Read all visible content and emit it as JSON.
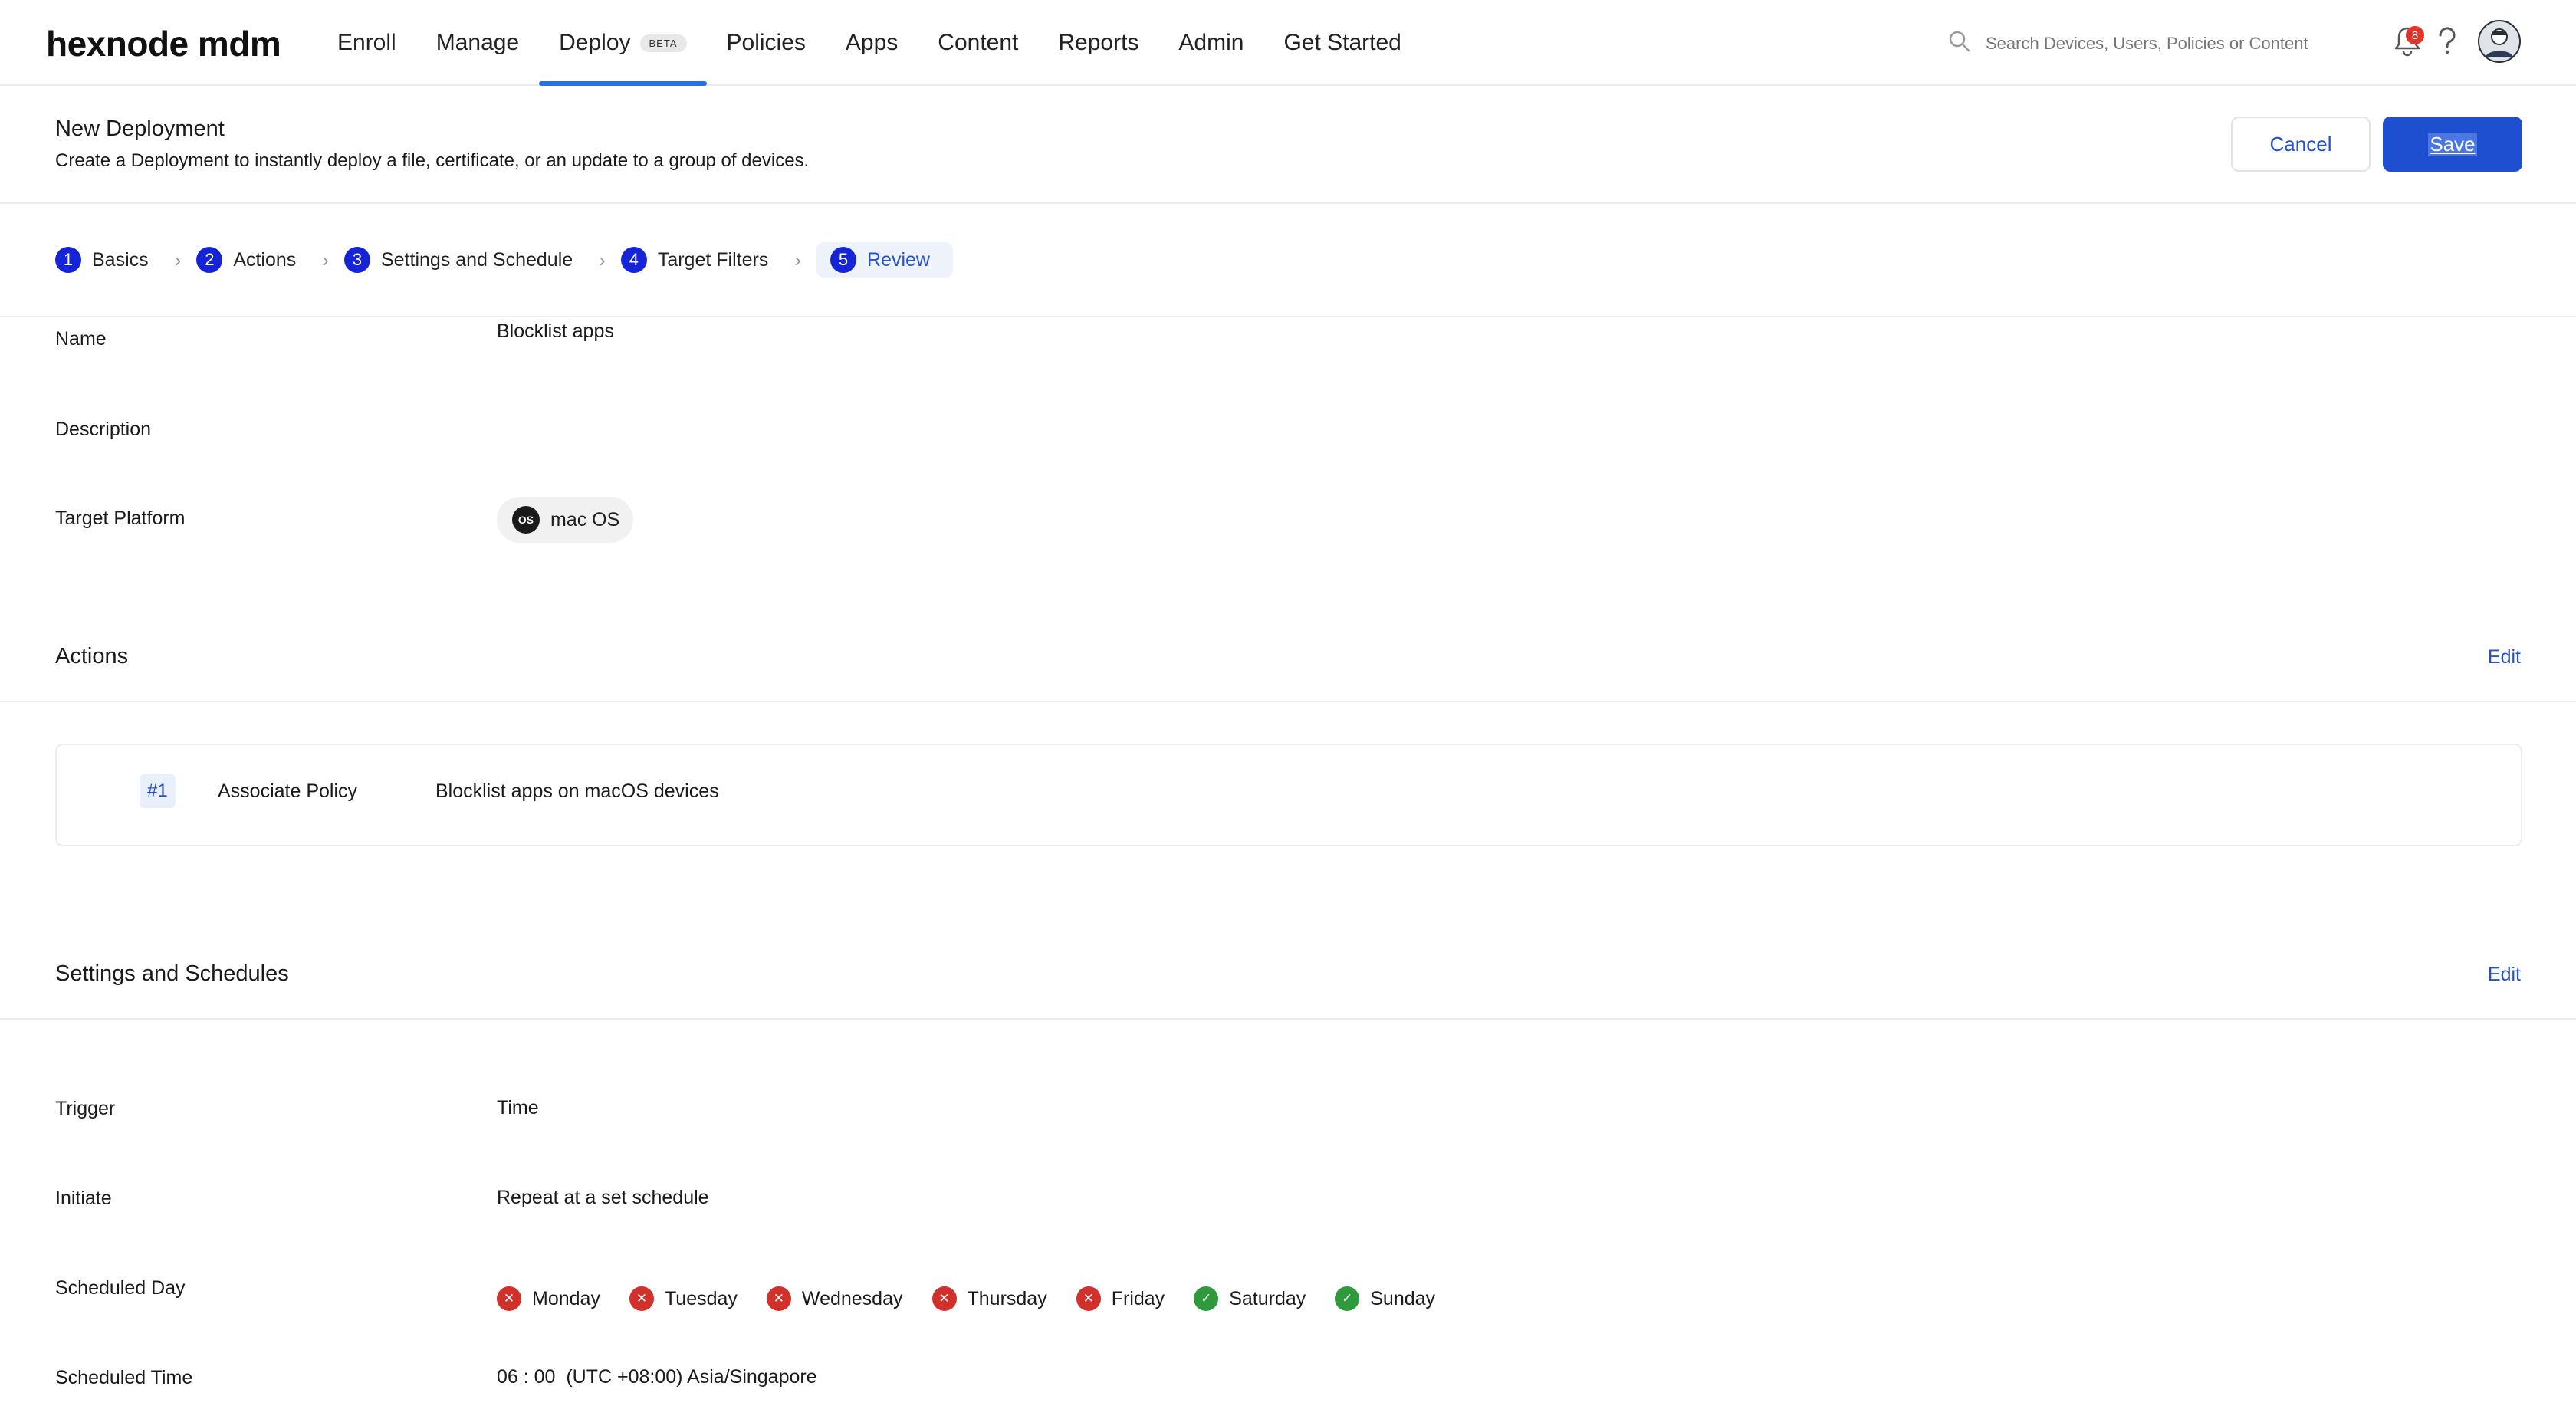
{
  "app": {
    "logo": "hexnode mdm"
  },
  "nav": {
    "items": [
      "Enroll",
      "Manage",
      "Deploy",
      "Policies",
      "Apps",
      "Content",
      "Reports",
      "Admin",
      "Get Started"
    ],
    "active": "Deploy",
    "beta_badge": "BETA"
  },
  "search": {
    "placeholder": "Search Devices, Users, Policies or Content"
  },
  "notifications": {
    "count": "8"
  },
  "header": {
    "title": "New Deployment",
    "subtitle": "Create a Deployment to instantly deploy a file, certificate, or an update to a group of devices.",
    "cancel_label": "Cancel",
    "save_label": "Save"
  },
  "steps": [
    {
      "num": "1",
      "label": "Basics"
    },
    {
      "num": "2",
      "label": "Actions"
    },
    {
      "num": "3",
      "label": "Settings and Schedule"
    },
    {
      "num": "4",
      "label": "Target Filters"
    },
    {
      "num": "5",
      "label": "Review"
    }
  ],
  "basics": {
    "name_label": "Name",
    "name_value": "Blocklist apps",
    "description_label": "Description",
    "platform_label": "Target Platform",
    "platform_value": "mac OS",
    "platform_icon_text": "OS"
  },
  "actions": {
    "title": "Actions",
    "edit_label": "Edit",
    "items": [
      {
        "num": "#1",
        "type": "Associate Policy",
        "description": "Blocklist apps on macOS devices"
      }
    ]
  },
  "settings": {
    "title": "Settings and Schedules",
    "edit_label": "Edit",
    "trigger_label": "Trigger",
    "trigger_value": "Time",
    "initiate_label": "Initiate",
    "initiate_value": "Repeat at a set schedule",
    "day_label": "Scheduled Day",
    "days": [
      {
        "name": "Monday",
        "enabled": false
      },
      {
        "name": "Tuesday",
        "enabled": false
      },
      {
        "name": "Wednesday",
        "enabled": false
      },
      {
        "name": "Thursday",
        "enabled": false
      },
      {
        "name": "Friday",
        "enabled": false
      },
      {
        "name": "Saturday",
        "enabled": true
      },
      {
        "name": "Sunday",
        "enabled": true
      }
    ],
    "time_label": "Scheduled Time",
    "time_value": "06 : 00",
    "timezone_value": "(UTC +08:00) Asia/Singapore"
  },
  "colors": {
    "accent": "#1e4fd1",
    "step": "#1424d6",
    "disabled_day": "#d1312b",
    "enabled_day": "#2e9a3c"
  }
}
